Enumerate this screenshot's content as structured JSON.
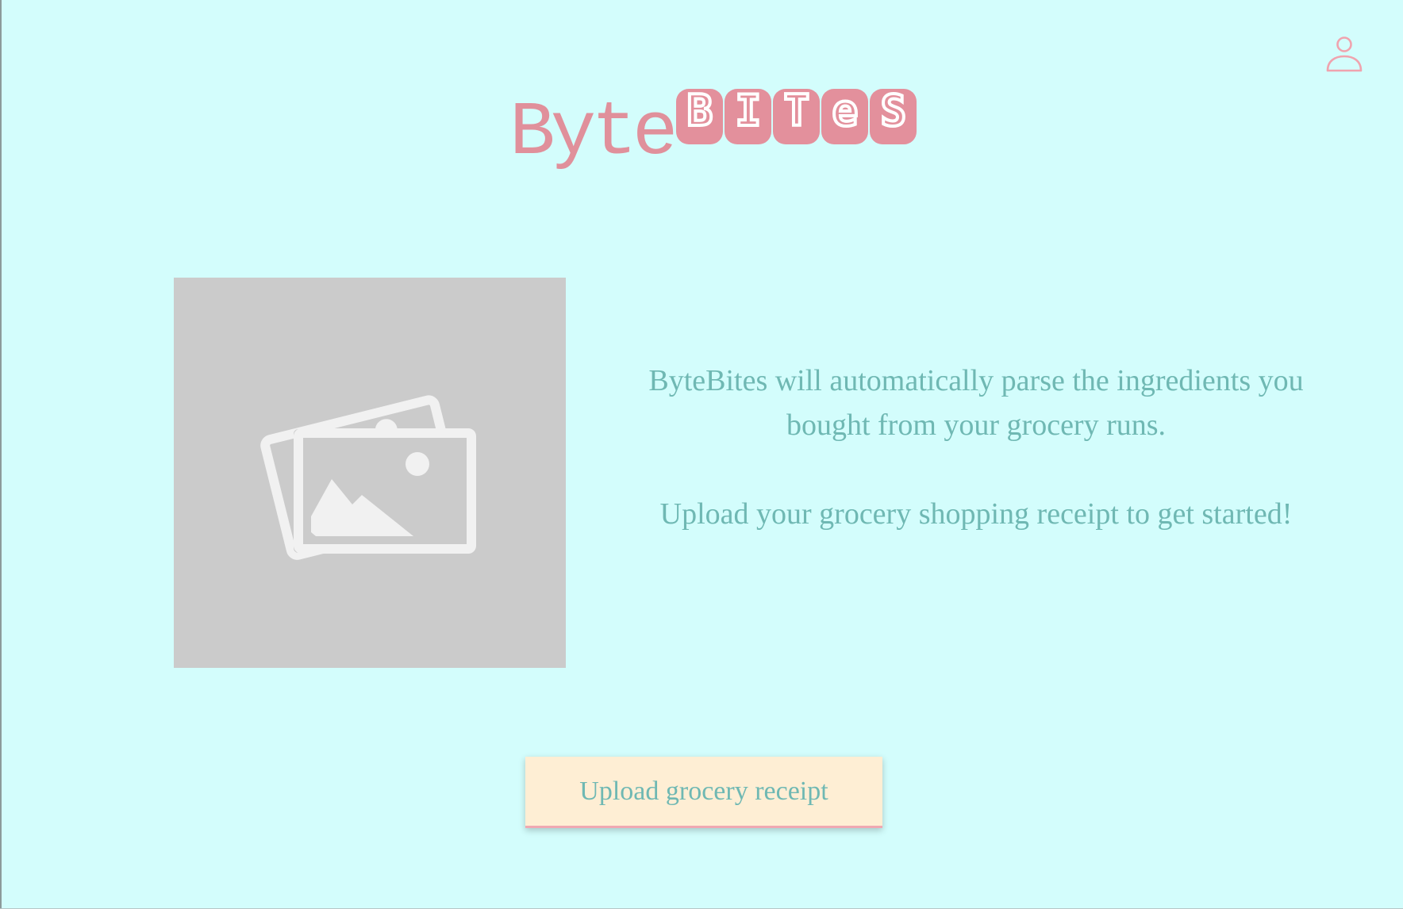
{
  "header": {
    "profile_icon": "user-profile-icon",
    "logo": {
      "byte_text": "Byte",
      "bites_letters": [
        "B",
        "I",
        "T",
        "e",
        "S"
      ]
    }
  },
  "main": {
    "image_placeholder_icon": "image-gallery-icon",
    "description": {
      "line1": "ByteBites will automatically parse the ingredients you bought from your grocery runs.",
      "line2": "Upload your grocery shopping receipt to get started!"
    },
    "upload_button_label": "Upload grocery receipt"
  },
  "colors": {
    "background": "#d3fdfc",
    "accent_pink": "#e3909c",
    "text_teal": "#6fb8b3",
    "button_bg": "#feeed4",
    "placeholder_bg": "#cbcbcb"
  }
}
